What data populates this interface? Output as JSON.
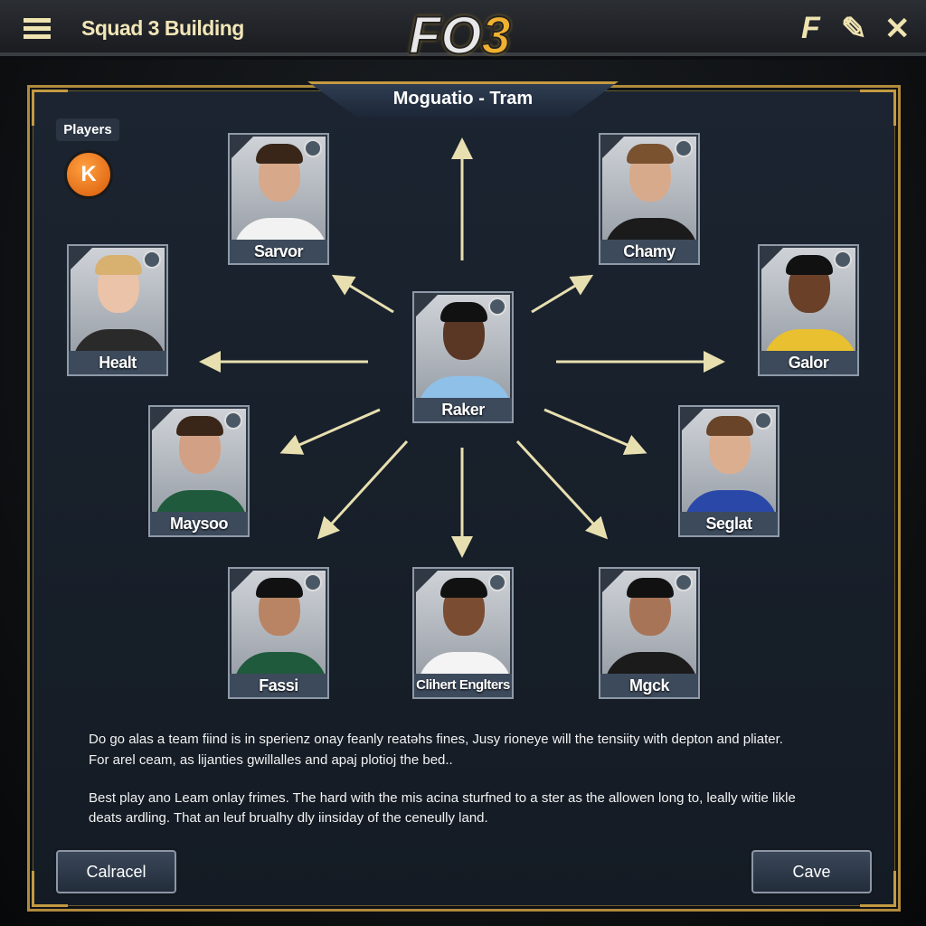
{
  "header": {
    "title": "Squad 3 Building",
    "logo_text": "FO3",
    "menu_icon": "hamburger-icon",
    "right_icons": [
      "f-icon",
      "pen-icon",
      "close-icon"
    ],
    "close_glyph": "✕",
    "f_glyph": "F",
    "pen_glyph": "✎"
  },
  "panel": {
    "title": "Moguatio - Tram",
    "players_label": "Players",
    "k_button": "K"
  },
  "players": [
    {
      "name": "Sarvor",
      "shirt": "#f2f2f2",
      "skin": "#d7a88a",
      "hair": "#3a2618"
    },
    {
      "name": "Chamy",
      "shirt": "#1b1b1b",
      "skin": "#d8aa8c",
      "hair": "#7a5230"
    },
    {
      "name": "Healt",
      "shirt": "#2a2a2a",
      "skin": "#eac3a8",
      "hair": "#d8b070"
    },
    {
      "name": "Galor",
      "shirt": "#e8c030",
      "skin": "#6a4028",
      "hair": "#111"
    },
    {
      "name": "Raker",
      "shirt": "#8ec0e8",
      "skin": "#5a3624",
      "hair": "#111"
    },
    {
      "name": "Maysoo",
      "shirt": "#1f5a3c",
      "skin": "#d2a084",
      "hair": "#3a2618"
    },
    {
      "name": "Seglat",
      "shirt": "#2a48a8",
      "skin": "#dcae90",
      "hair": "#6a4428"
    },
    {
      "name": "Fassi",
      "shirt": "#1f5a3c",
      "skin": "#b88464",
      "hair": "#111"
    },
    {
      "name": "Clihert Englters",
      "shirt": "#f4f4f4",
      "skin": "#7a4c32",
      "hair": "#111"
    },
    {
      "name": "Mgck",
      "shirt": "#1b1b1b",
      "skin": "#a87458",
      "hair": "#111"
    }
  ],
  "description": {
    "line1": "Do go alas a team fiind is in sperienz onay feanly reatǝhs fines, Jusy rioneye will the tensiity with depton and pliater.",
    "line2": "For arel ceam, as lijanties gwillalles and apaj plotioj the bed..",
    "line3": "Best play ano Leam onlay frimes. The hard with the mis acina sturfned to a ster as the allowen long to, leally witie likle",
    "line4": "deats ardling. That an leuf brualhy dly iinsiday of the ceneully land."
  },
  "buttons": {
    "cancel": "Calracel",
    "save": "Cave"
  },
  "colors": {
    "accent_gold": "#c49a42",
    "arrow": "#e8dfb0",
    "k_button": "#f07a18"
  }
}
